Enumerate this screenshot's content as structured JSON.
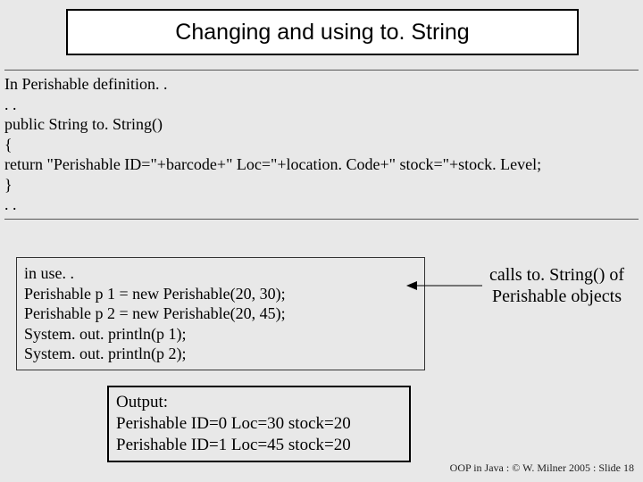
{
  "title": "Changing and using to. String",
  "definition": {
    "line1": "In Perishable definition. .",
    "line2": ". .",
    "line3": "public String to. String()",
    "line4": "{",
    "line5": " return \"Perishable ID=\"+barcode+\" Loc=\"+location. Code+\" stock=\"+stock. Level;",
    "line6": "}",
    "line7": ". ."
  },
  "inuse": {
    "line1": "in use. .",
    "line2": "Perishable p 1 = new Perishable(20, 30);",
    "line3": "Perishable p 2 = new Perishable(20, 45);",
    "line4": "System. out. println(p 1);",
    "line5": "System. out. println(p 2);"
  },
  "callout": {
    "line1": "calls to. String() of",
    "line2": "Perishable objects"
  },
  "output": {
    "line1": "Output:",
    "line2": "Perishable ID=0 Loc=30 stock=20",
    "line3": "Perishable ID=1 Loc=45 stock=20"
  },
  "footer": "OOP in Java : © W. Milner 2005 : Slide 18"
}
